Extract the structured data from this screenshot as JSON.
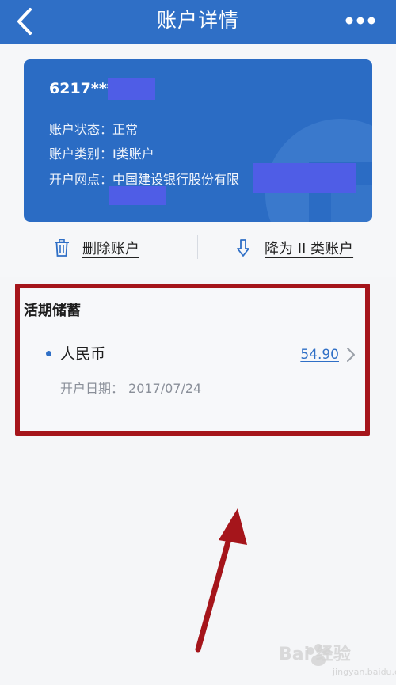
{
  "header": {
    "title": "账户详情",
    "back_icon": "chevron-left-icon",
    "more_icon": "more-dots-icon",
    "color": "#2f6fc6"
  },
  "card": {
    "number_prefix": "6217***",
    "status": {
      "label": "账户状态：",
      "value": "正常"
    },
    "type": {
      "label": "账户类别：",
      "value": "I类账户"
    },
    "branch": {
      "label": "开户网点：",
      "value": "中国建设银行股份有限"
    },
    "color": "#2b6cc4"
  },
  "actions": {
    "delete": {
      "label": "删除账户",
      "icon": "trash-icon"
    },
    "downgrade": {
      "label": "降为 II 类账户",
      "icon": "arrow-down-icon"
    }
  },
  "savings": {
    "title": "活期储蓄",
    "items": [
      {
        "currency": "人民币",
        "balance": "54.90",
        "open_date_label": "开户日期：",
        "open_date": "2017/07/24"
      }
    ]
  },
  "annotation": {
    "color": "#a5151b"
  },
  "watermark": {
    "text": "Bai 经验",
    "sub": "jingyan.baidu.com"
  }
}
